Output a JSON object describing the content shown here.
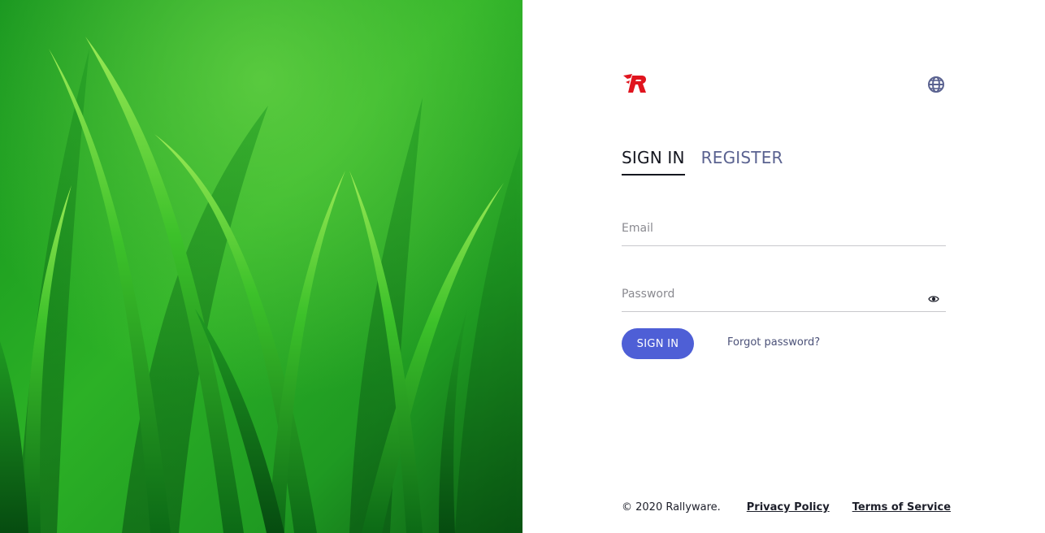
{
  "hero": {
    "image": "green-grass-photo",
    "colors": {
      "dark": "#0d6a17",
      "mid": "#27a424",
      "light": "#7fe33a"
    }
  },
  "header": {
    "logo_icon": "rallyware-r-logo",
    "logo_color": "#e0141e",
    "language_icon": "globe-icon"
  },
  "tabs": [
    {
      "label": "SIGN IN",
      "active": true
    },
    {
      "label": "REGISTER",
      "active": false
    }
  ],
  "form": {
    "email_placeholder": "Email",
    "email_value": "",
    "password_placeholder": "Password",
    "password_value": "",
    "password_toggle_icon": "eye-icon",
    "submit_label": "SIGN IN",
    "forgot_label": "Forgot password?"
  },
  "footer": {
    "copyright": "© 2020 Rallyware.",
    "privacy_label": "Privacy Policy",
    "terms_label": "Terms of Service"
  },
  "colors": {
    "accent": "#4e5fd6",
    "tab_active": "#14161f",
    "tab_inactive": "#5a6290"
  }
}
